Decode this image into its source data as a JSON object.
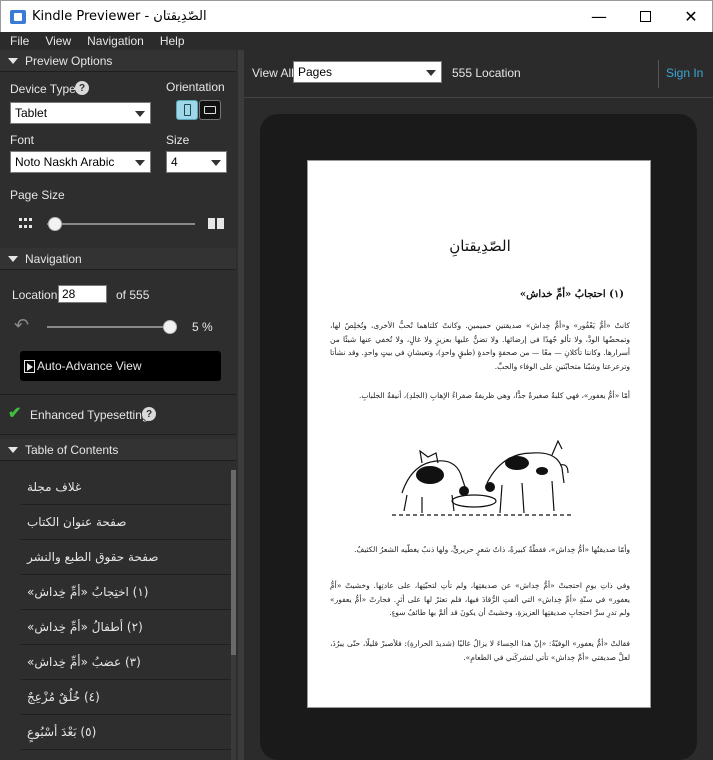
{
  "window": {
    "title": "Kindle Previewer - الصّدِيقتان"
  },
  "menu": [
    "File",
    "View",
    "Navigation",
    "Help"
  ],
  "preview_options": {
    "header": "Preview Options",
    "device_type_label": "Device Type",
    "device_type_value": "Tablet",
    "orientation_label": "Orientation",
    "font_label": "Font",
    "font_value": "Noto Naskh Arabic",
    "size_label": "Size",
    "size_value": "4",
    "page_size_label": "Page Size",
    "page_size_level": 0.0
  },
  "navigation": {
    "header": "Navigation",
    "location_label": "Location",
    "location_value": "28",
    "of_label": "of 555",
    "progress_text": "5 %",
    "progress_fraction": 0.05,
    "auto_advance_label": "Auto-Advance View"
  },
  "enhanced": {
    "label": "Enhanced Typesetting"
  },
  "toc": {
    "header": "Table of Contents",
    "items": [
      "غلاف مجلة",
      "صفحة عنوان الكتاب",
      "صفحة حقوق الطبع والنشر",
      "(١) اختِجابُ «أمِّ خِداش»",
      "(٢) أطفالُ «أمِّ خِداش»",
      "(٣) عضبُ «أمِّ خِداش»",
      "(٤) خُلُقٌ مُزْعِجٌ",
      "(٥) بَعْدَ أسْبُوعٍ"
    ]
  },
  "toolbar": {
    "view_all_label": "View All",
    "view_select": "Pages",
    "location_text": "555 Location",
    "sign_in": "Sign In"
  },
  "book": {
    "title": "الصّدِيقتانِ",
    "chapter_heading": "(١) احتجابُ «أمِّ خداش»",
    "para1": "كانتْ «أمُّ يَعْفُور» و«أمُّ خِداش» صديقتينِ حميمينِ. وكانتْ كلتاهما تُحبُّ الأخرى، وتُخلِصُ لها، وتمحضُها الودَّ، ولا تألو جُهدًا في إرضائها. ولا تضنُّ عليها بعزيزٍ ولا غالٍ، ولا تُخفي عنها شيئًا من أسرارها. وكانتا تأكلانِ — معًا — من صحفةٍ واحدةٍ (طبقٍ واحدٍ)، وتعيشانِ في بيتٍ واحدٍ. وقد نشأتا وترعرعتا وشبّتا متحابّتينِ على الوفاء والحبِّ.",
    "para2": "أمّا «أمُّ يعفور»، فهي كلبةٌ صغيرةٌ جدًّا، وهي ظريفةٌ صفراءُ الإهابِ (الجلدِ)، أنيقةُ الجلبابِ.",
    "para3": "وأمّا صديقتُها «أمُّ خِداش»، فقطّةٌ كبيرةٌ، ذاتُ شعرٍ حريريٍّ، ولها ذنبٌ يغطّيه الشعرُ الكثيفُ.",
    "para4": "وفي ذاتِ يومٍ احتجبتْ «أمُّ خِداش» عن صديقتِها، ولم تأتِ لتحيّتِها، على عادتِها. وخشيتْ «أمُّ يعفور» في سنّةِ «أمِّ خِداش» التي ألفتِ الرُّقادَ فيها، فلم تعثرْ لها على أثرٍ. فحارتْ «أمُّ يعفور» ولم تدرِ سرَّ احتجابِ صديقتِها العزيزةِ، وخشيتْ أن يكونَ قد ألمَّ بها طائفُ سوءٍ.",
    "para5": "فقالتْ «أمُّ يعفور» الوفيّةُ: «إنّ هذا الحِساءَ لا يزالُ غاليًا (شديدَ الحرارةِ): فلأصبرْ قليلًا، حتّى يبرُدَ، لعلَّ صديقتي «أمَّ خِداش» تأتي لتشركَني في الطعامِ»."
  }
}
